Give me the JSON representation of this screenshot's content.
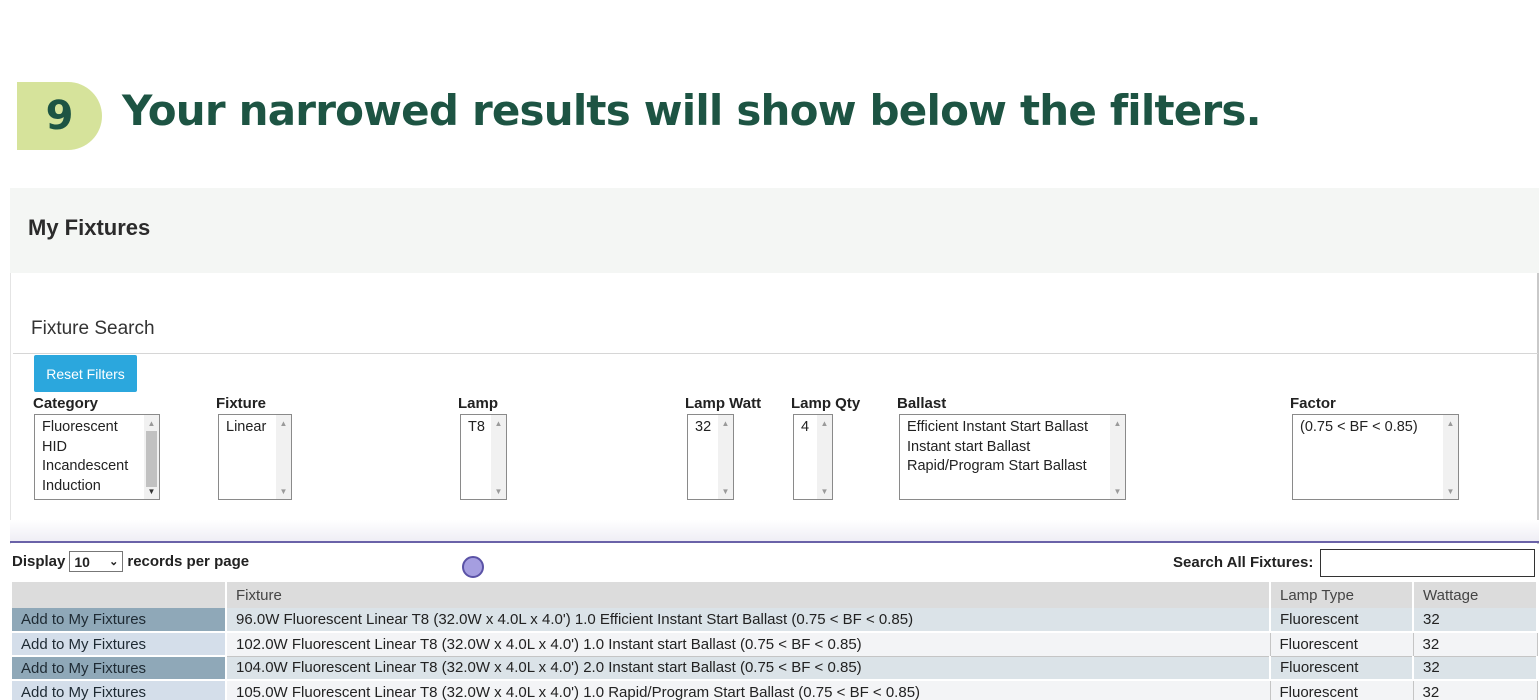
{
  "step": {
    "number": "9",
    "title": "Your narrowed results will show below the filters."
  },
  "panel": {
    "title": "My Fixtures",
    "search_heading": "Fixture Search",
    "reset_label": "Reset Filters"
  },
  "filters": {
    "category": {
      "label": "Category",
      "options": [
        "Fluorescent",
        "HID",
        "Incandescent",
        "Induction"
      ]
    },
    "fixture": {
      "label": "Fixture",
      "options": [
        "Linear"
      ]
    },
    "lamp": {
      "label": "Lamp",
      "options": [
        "T8"
      ]
    },
    "lamp_watt": {
      "label": "Lamp Watt",
      "options": [
        "32"
      ]
    },
    "lamp_qty": {
      "label": "Lamp Qty",
      "options": [
        "4"
      ]
    },
    "ballast": {
      "label": "Ballast",
      "options": [
        "Efficient Instant Start Ballast",
        "Instant start Ballast",
        "Rapid/Program Start Ballast"
      ]
    },
    "factor": {
      "label": "Factor",
      "options": [
        "(0.75 < BF < 0.85)"
      ]
    }
  },
  "table_controls": {
    "display_prefix": "Display",
    "page_size": "10",
    "display_suffix": "records per page",
    "search_label": "Search All Fixtures:",
    "search_value": ""
  },
  "table": {
    "columns": [
      "",
      "Fixture",
      "Lamp Type",
      "Wattage"
    ],
    "rows": [
      {
        "action": "Add to My Fixtures",
        "fixture": "96.0W Fluorescent Linear T8 (32.0W x 4.0L x 4.0') 1.0 Efficient Instant Start Ballast (0.75 < BF < 0.85)",
        "lamp_type": "Fluorescent",
        "wattage": "32"
      },
      {
        "action": "Add to My Fixtures",
        "fixture": "102.0W Fluorescent Linear T8 (32.0W x 4.0L x 4.0') 1.0 Instant start Ballast (0.75 < BF < 0.85)",
        "lamp_type": "Fluorescent",
        "wattage": "32"
      },
      {
        "action": "Add to My Fixtures",
        "fixture": "104.0W Fluorescent Linear T8 (32.0W x 4.0L x 4.0') 2.0 Instant start Ballast (0.75 < BF < 0.85)",
        "lamp_type": "Fluorescent",
        "wattage": "32"
      },
      {
        "action": "Add to My Fixtures",
        "fixture": "105.0W Fluorescent Linear T8 (32.0W x 4.0L x 4.0') 1.0 Rapid/Program Start Ballast (0.75 < BF < 0.85)",
        "lamp_type": "Fluorescent",
        "wattage": "32"
      }
    ]
  },
  "colors": {
    "heading_green": "#1d5443",
    "badge_green": "#d6e39b",
    "button_blue": "#2ba7dd",
    "divider_purple": "#6a62a8"
  }
}
